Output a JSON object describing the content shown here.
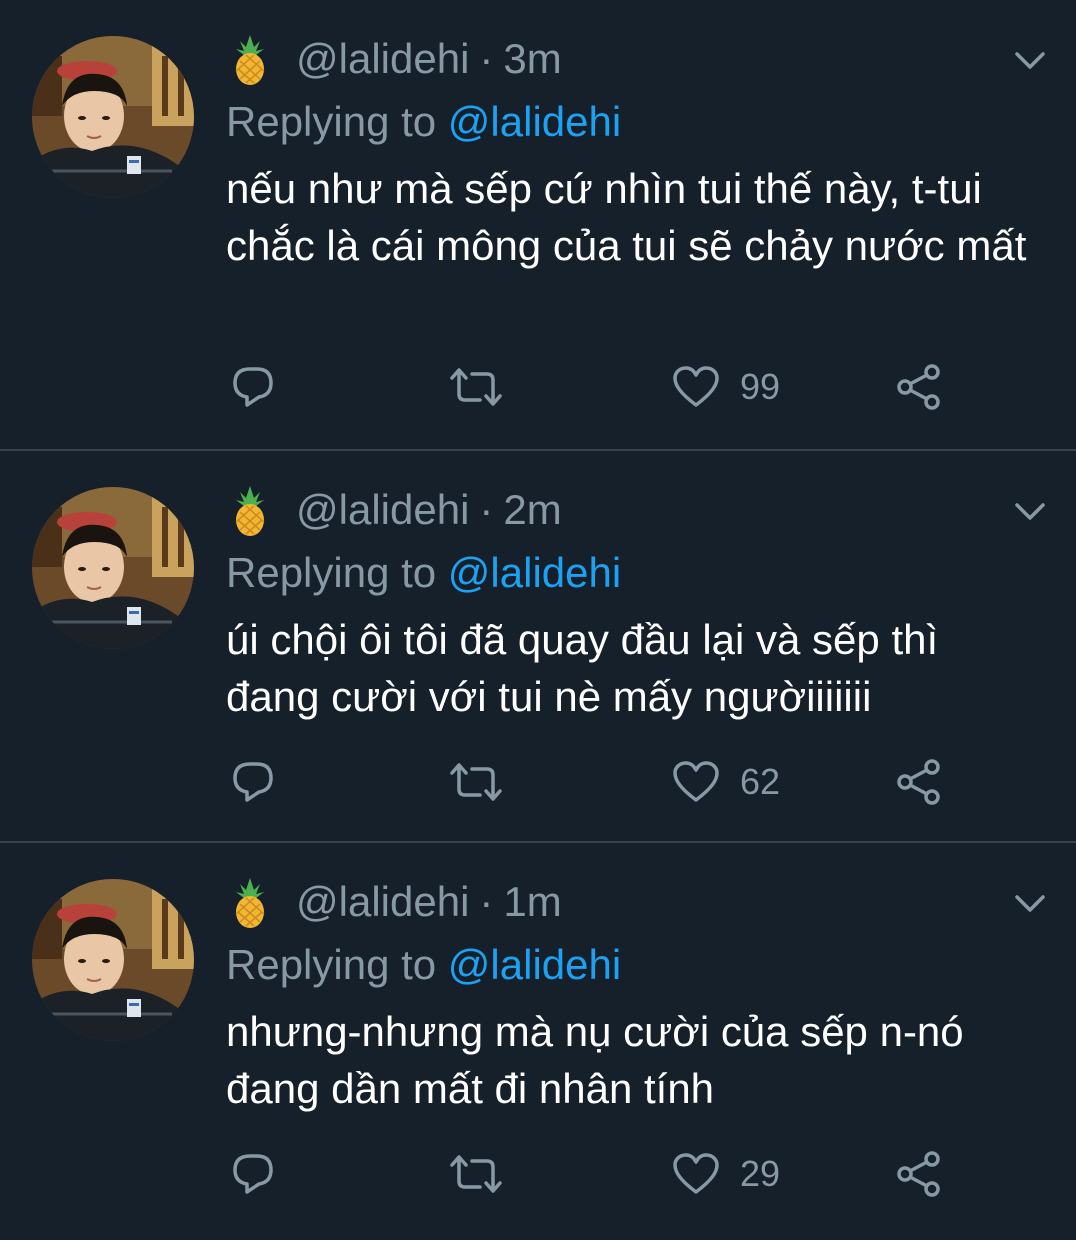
{
  "tweets": [
    {
      "handle": "@lalidehi",
      "time": "3m",
      "replying_label": "Replying to",
      "replying_handle": "@lalidehi",
      "text": "nếu như mà sếp cứ nhìn tui thế này, t-tui chắc là cái mông của tui sẽ chảy nước mất",
      "likes": "99"
    },
    {
      "handle": "@lalidehi",
      "time": "2m",
      "replying_label": "Replying to",
      "replying_handle": "@lalidehi",
      "text": "úi chội ôi tôi đã quay đầu lại và sếp thì đang cười với tui nè mấy ngườiiiiiii",
      "likes": "62"
    },
    {
      "handle": "@lalidehi",
      "time": "1m",
      "replying_label": "Replying to",
      "replying_handle": "@lalidehi",
      "text": "nhưng-nhưng mà nụ cười của sếp n-nó đang dần mất đi nhân tính",
      "likes": "29"
    }
  ],
  "separator": "·",
  "icons": {
    "name_emoji": "pineapple-icon",
    "reply": "reply-icon",
    "retweet": "retweet-icon",
    "like": "heart-icon",
    "share": "share-icon",
    "menu": "chevron-down-icon"
  },
  "colors": {
    "background": "#15202b",
    "text": "#ffffff",
    "muted": "#8899a6",
    "link": "#1da1f2",
    "divider": "#38444d"
  }
}
